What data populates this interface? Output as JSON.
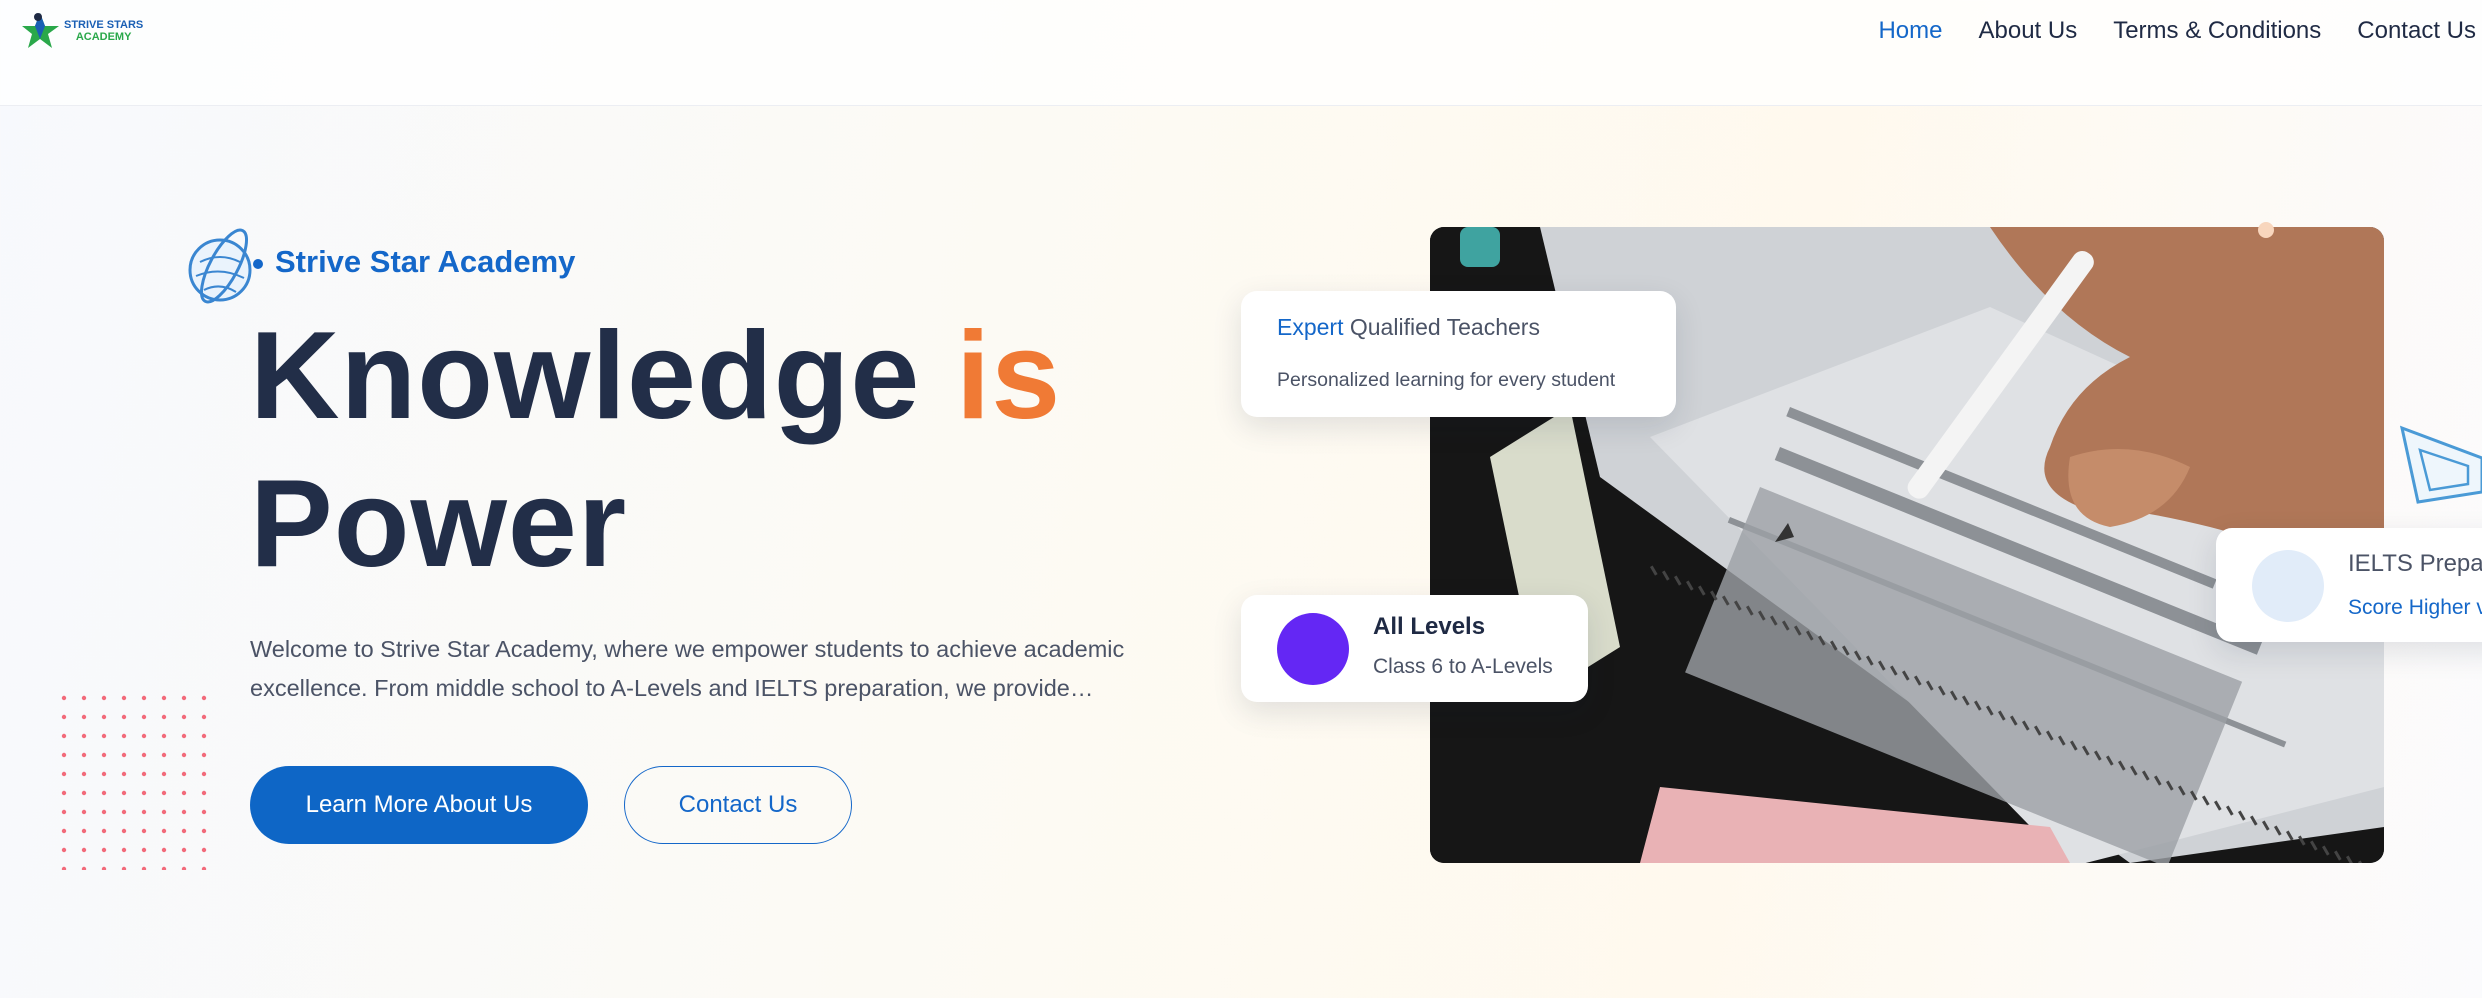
{
  "header": {
    "logo": {
      "line1": "STRIVE STARS",
      "line2": "ACADEMY"
    },
    "nav": [
      {
        "label": "Home",
        "active": true
      },
      {
        "label": "About Us",
        "active": false
      },
      {
        "label": "Terms & Conditions",
        "active": false
      },
      {
        "label": "Contact Us",
        "active": false
      }
    ]
  },
  "hero": {
    "eyebrow": "Strive Star Academy",
    "headline": {
      "part1": "Knowledge",
      "accent": "is",
      "part2": "Power"
    },
    "description": "Welcome to Strive Star Academy, where we empower students to achieve academic excellence. From middle school to A-Levels and IELTS preparation, we provide…",
    "primary_button": "Learn More About Us",
    "secondary_button": "Contact Us"
  },
  "cards": {
    "teachers": {
      "highlight": "Expert",
      "title": "Qualified Teachers",
      "subtitle": "Personalized learning for every student"
    },
    "levels": {
      "title": "All Levels",
      "subtitle": "Class 6 to A-Levels"
    },
    "ielts": {
      "title": "IELTS Prepa",
      "subtitle": "Score Higher v"
    }
  },
  "colors": {
    "primary": "#0e66c6",
    "accent": "#f07a35",
    "heading": "#222e48",
    "purple": "#6427f4"
  }
}
